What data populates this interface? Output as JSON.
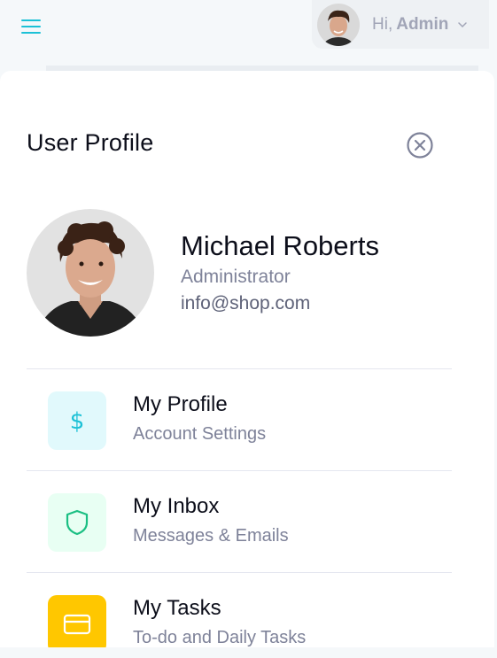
{
  "header": {
    "menu_icon": "hamburger-icon",
    "greeting": "Hi,",
    "user_name": "Admin",
    "caret_icon": "chevron-down-icon",
    "accent_color": "#1cc1d6"
  },
  "panel": {
    "title": "User Profile",
    "close_icon": "close-circle-icon"
  },
  "profile": {
    "name": "Michael Roberts",
    "role": "Administrator",
    "email": "info@shop.com"
  },
  "menu": [
    {
      "title": "My Profile",
      "subtitle": "Account Settings",
      "icon": "dollar-icon",
      "icon_bg": "#e1f9fc",
      "icon_color": "#1cc1d6"
    },
    {
      "title": "My Inbox",
      "subtitle": "Messages & Emails",
      "icon": "shield-icon",
      "icon_bg": "#e8fff3",
      "icon_color": "#1bbf83"
    },
    {
      "title": "My Tasks",
      "subtitle": "To-do and Daily Tasks",
      "icon": "card-icon",
      "icon_bg": "#ffc700",
      "icon_color": "#ffffff"
    }
  ]
}
